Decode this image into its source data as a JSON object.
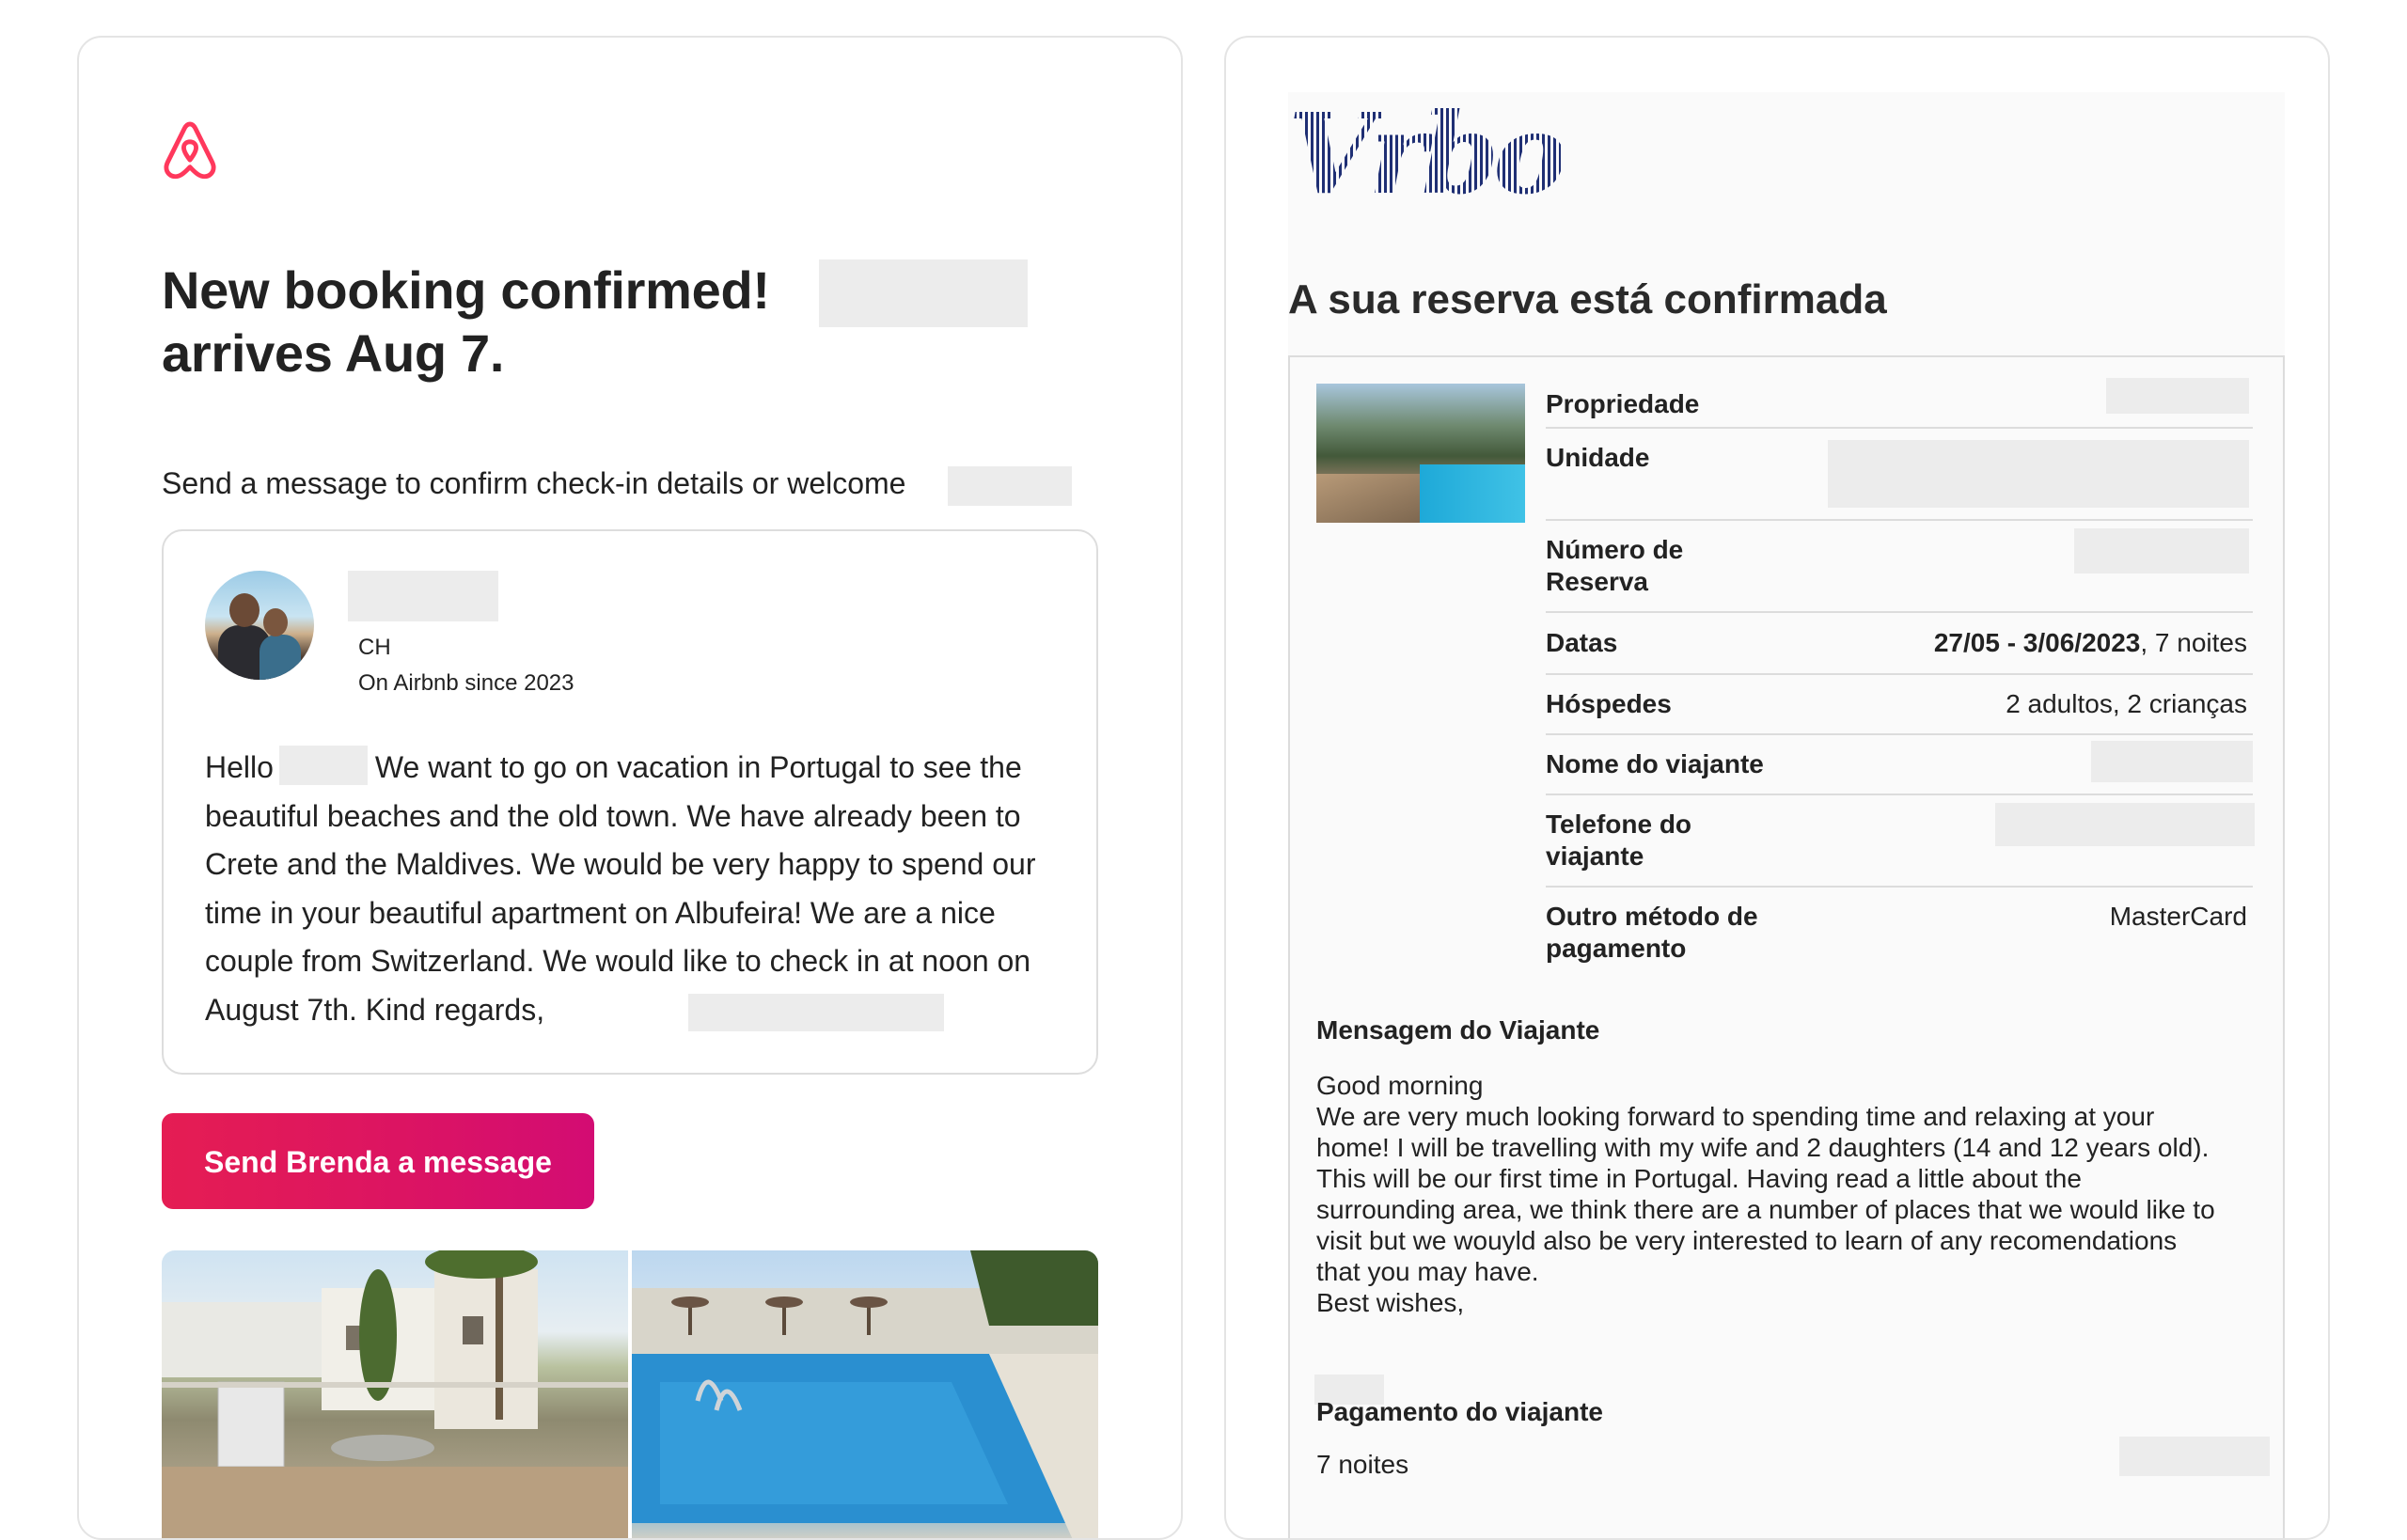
{
  "airbnb": {
    "logo_icon": "airbnb-logo-icon",
    "brand_color": "#ff385c",
    "title_line1": "New booking confirmed!",
    "title_line2": "arrives Aug 7.",
    "subtitle": "Send a message to confirm check-in details or welcome",
    "guest": {
      "country": "CH",
      "member_since": "On Airbnb since 2023"
    },
    "message_hello": "Hello",
    "message_body": "We want to go on vacation in Portugal to see the beautiful beaches and the old town. We have already been to Crete and the Maldives. We would be very happy to spend our time in your beautiful apartment on Albufeira! We are a nice couple from Switzerland. We would like to check in at noon on August 7th. Kind regards,",
    "send_button": "Send Brenda a message"
  },
  "vrbo": {
    "logo_text": "Vrbo",
    "logo_color": "#1e3378",
    "title": "A sua reserva está confirmada",
    "details": [
      {
        "label": "Propriedade",
        "value": ""
      },
      {
        "label": "Unidade",
        "value": ""
      },
      {
        "label": "Número de Reserva",
        "value": ""
      },
      {
        "label": "Datas",
        "value_bold": "27/05 - 3/06/2023",
        "value": ", 7 noites"
      },
      {
        "label": "Hóspedes",
        "value": "2 adultos, 2 crianças"
      },
      {
        "label": "Nome do viajante",
        "value": ""
      },
      {
        "label": "Telefone do viajante",
        "value": ""
      },
      {
        "label": "Outro método de pagamento",
        "value": "MasterCard"
      }
    ],
    "traveler_message_heading": "Mensagem do Viajante",
    "traveler_message_lines": [
      "Good morning",
      "We are very much looking forward to spending time and relaxing at your",
      "home! I will be travelling with my wife and 2 daughters (14 and 12 years old).",
      "This will be our first time in Portugal. Having read a little about the",
      "surrounding area, we think there are a number of places that we would like to",
      "visit but we wouyld also be very interested to learn of any recomendations",
      "that you may have.",
      "Best wishes,"
    ],
    "payment_heading": "Pagamento do viajante",
    "payment_nights": "7 noites"
  }
}
